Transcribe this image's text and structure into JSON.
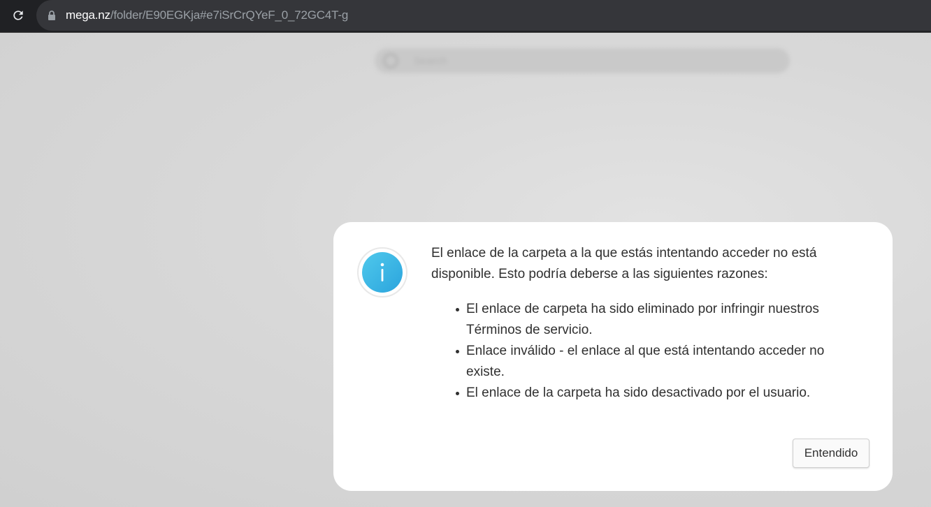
{
  "browser": {
    "url_domain": "mega.nz",
    "url_path": "/folder/E90EGKja#e7iSrCrQYeF_0_72GC4T-g",
    "icons": {
      "reload": "reload-icon",
      "lock": "lock-icon"
    }
  },
  "background": {
    "search_placeholder": "Search"
  },
  "dialog": {
    "icon": "info-icon",
    "message": "El enlace de la carpeta a la que estás intentando acceder no está disponible. Esto podría deberse a las siguientes razones:",
    "reasons": [
      "El enlace de carpeta ha sido eliminado por infringir nuestros Términos de servicio.",
      "Enlace inválido - el enlace al que está intentando acceder no existe.",
      "El enlace de la carpeta ha sido desactivado por el usuario."
    ],
    "button_label": "Entendido",
    "accent_color": "#2ba4dd"
  }
}
